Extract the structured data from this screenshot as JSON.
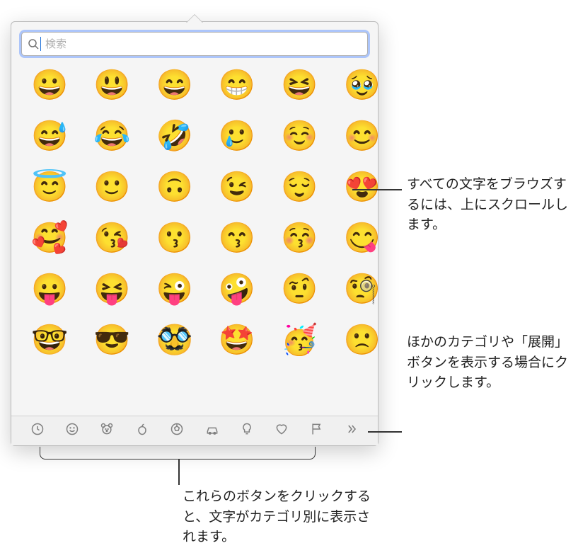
{
  "search": {
    "placeholder": "検索"
  },
  "emoji_grid": [
    [
      "😀",
      "😃",
      "😄",
      "😁",
      "😆",
      "🥹"
    ],
    [
      "😅",
      "😂",
      "🤣",
      "🥲",
      "☺️",
      "😊"
    ],
    [
      "😇",
      "🙂",
      "🙃",
      "😉",
      "😌",
      "😍"
    ],
    [
      "🥰",
      "😘",
      "😗",
      "😙",
      "😚",
      "😋"
    ],
    [
      "😛",
      "😝",
      "😜",
      "🤪",
      "🤨",
      "🧐"
    ],
    [
      "🤓",
      "😎",
      "🥸",
      "🤩",
      "🥳",
      "🙁"
    ]
  ],
  "categories": [
    {
      "name": "recent",
      "icon": "clock-icon"
    },
    {
      "name": "smileys",
      "icon": "smiley-icon"
    },
    {
      "name": "animals",
      "icon": "animal-icon"
    },
    {
      "name": "food",
      "icon": "apple-icon"
    },
    {
      "name": "activity",
      "icon": "soccer-icon"
    },
    {
      "name": "travel",
      "icon": "car-icon"
    },
    {
      "name": "objects",
      "icon": "bulb-icon"
    },
    {
      "name": "symbols",
      "icon": "heart-icon"
    },
    {
      "name": "flags",
      "icon": "flag-icon"
    },
    {
      "name": "expand",
      "icon": "chevrons-icon"
    }
  ],
  "callouts": {
    "scroll": "すべての文字をブラウズするには、上にスクロールします。",
    "expand": "ほかのカテゴリや「展開」ボタンを表示する場合にクリックします。",
    "categories": "これらのボタンをクリックすると、文字がカテゴリ別に表示されます。"
  }
}
